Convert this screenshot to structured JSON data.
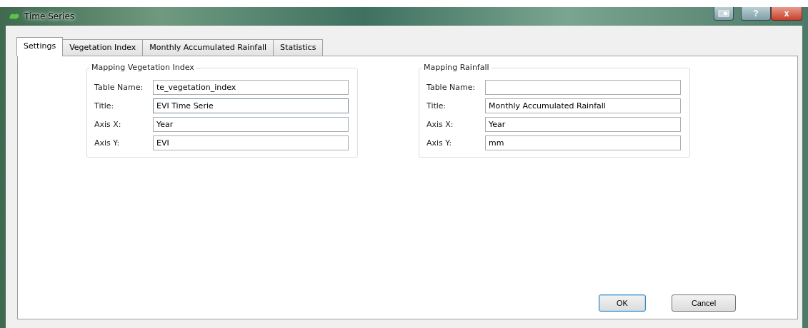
{
  "window": {
    "title": "Time Series",
    "buttons": [
      {
        "kind": "restore"
      },
      {
        "kind": "help",
        "label": "?"
      },
      {
        "kind": "close",
        "label": "x"
      }
    ]
  },
  "tabs": [
    {
      "label": "Settings",
      "selected": true
    },
    {
      "label": "Vegetation Index",
      "selected": false
    },
    {
      "label": "Monthly Accumulated Rainfall",
      "selected": false
    },
    {
      "label": "Statistics",
      "selected": false
    }
  ],
  "groups": [
    {
      "title": "Mapping Vegetation Index",
      "fields": [
        {
          "label": "Table Name:",
          "value": "te_vegetation_index",
          "focused": false
        },
        {
          "label": "Title:",
          "value": "EVI Time Serie",
          "focused": true
        },
        {
          "label": "Axis X:",
          "value": "Year",
          "focused": false
        },
        {
          "label": "Axis Y:",
          "value": "EVI",
          "focused": false
        }
      ]
    },
    {
      "title": "Mapping Rainfall",
      "fields": [
        {
          "label": "Table Name:",
          "focused": false
        },
        {
          "label": "Title:",
          "value": "Monthly Accumulated Rainfall",
          "focused": false
        },
        {
          "label": "Axis X:",
          "value": "Year",
          "focused": false
        },
        {
          "label": "Axis Y:",
          "value": "mm",
          "focused": false
        }
      ]
    }
  ],
  "buttons": [
    {
      "label": "OK",
      "default": true
    },
    {
      "label": "Cancel",
      "default": false
    }
  ]
}
